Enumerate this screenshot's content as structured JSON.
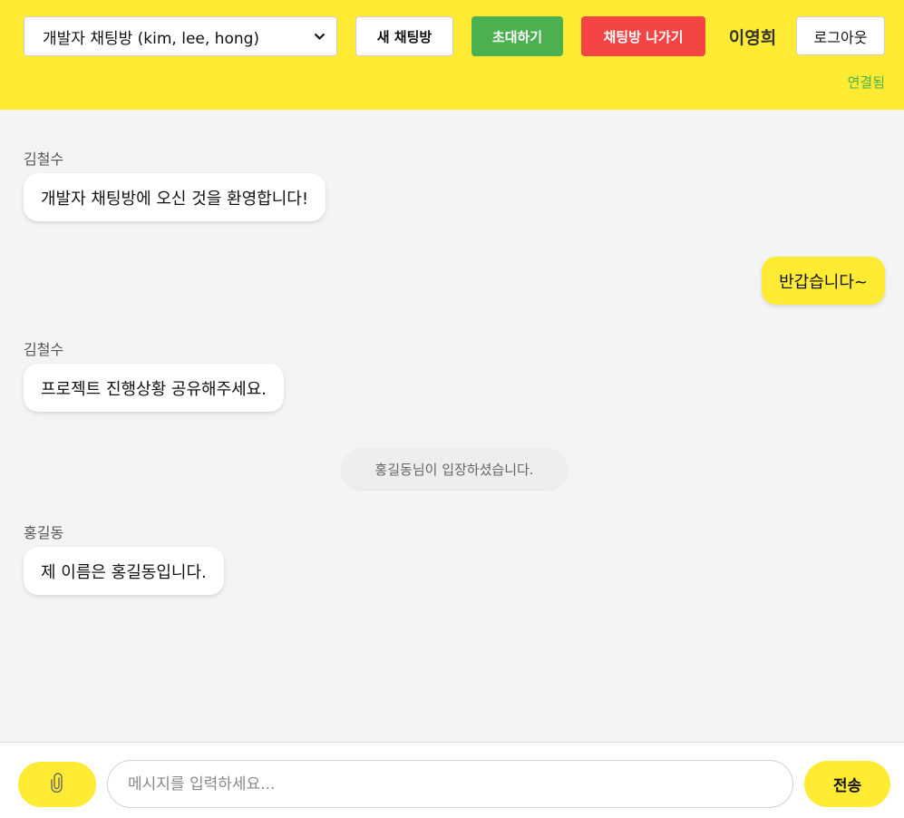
{
  "header": {
    "room_select": {
      "selected": "개발자 채팅방 (kim, lee, hong)"
    },
    "new_room_label": "새 채팅방",
    "invite_label": "초대하기",
    "leave_label": "채팅방 나가기",
    "user_name": "이영희",
    "logout_label": "로그아웃",
    "status": "연결됨",
    "colors": {
      "bar": "#ffeb33",
      "invite": "#4caf50",
      "leave": "#f44444",
      "status": "#4caf50"
    }
  },
  "messages": [
    {
      "type": "incoming",
      "sender": "김철수",
      "text": "개발자 채팅방에 오신 것을 환영합니다!"
    },
    {
      "type": "outgoing",
      "text": "반갑습니다~"
    },
    {
      "type": "incoming",
      "sender": "김철수",
      "text": "프로젝트 진행상황 공유해주세요."
    },
    {
      "type": "system",
      "text": "홍길동님이 입장하셨습니다."
    },
    {
      "type": "incoming",
      "sender": "홍길동",
      "text": "제 이름은 홍길동입니다."
    }
  ],
  "composer": {
    "attach_icon": "paperclip-icon",
    "input_value": "",
    "input_placeholder": "메시지를 입력하세요...",
    "send_label": "전송"
  }
}
